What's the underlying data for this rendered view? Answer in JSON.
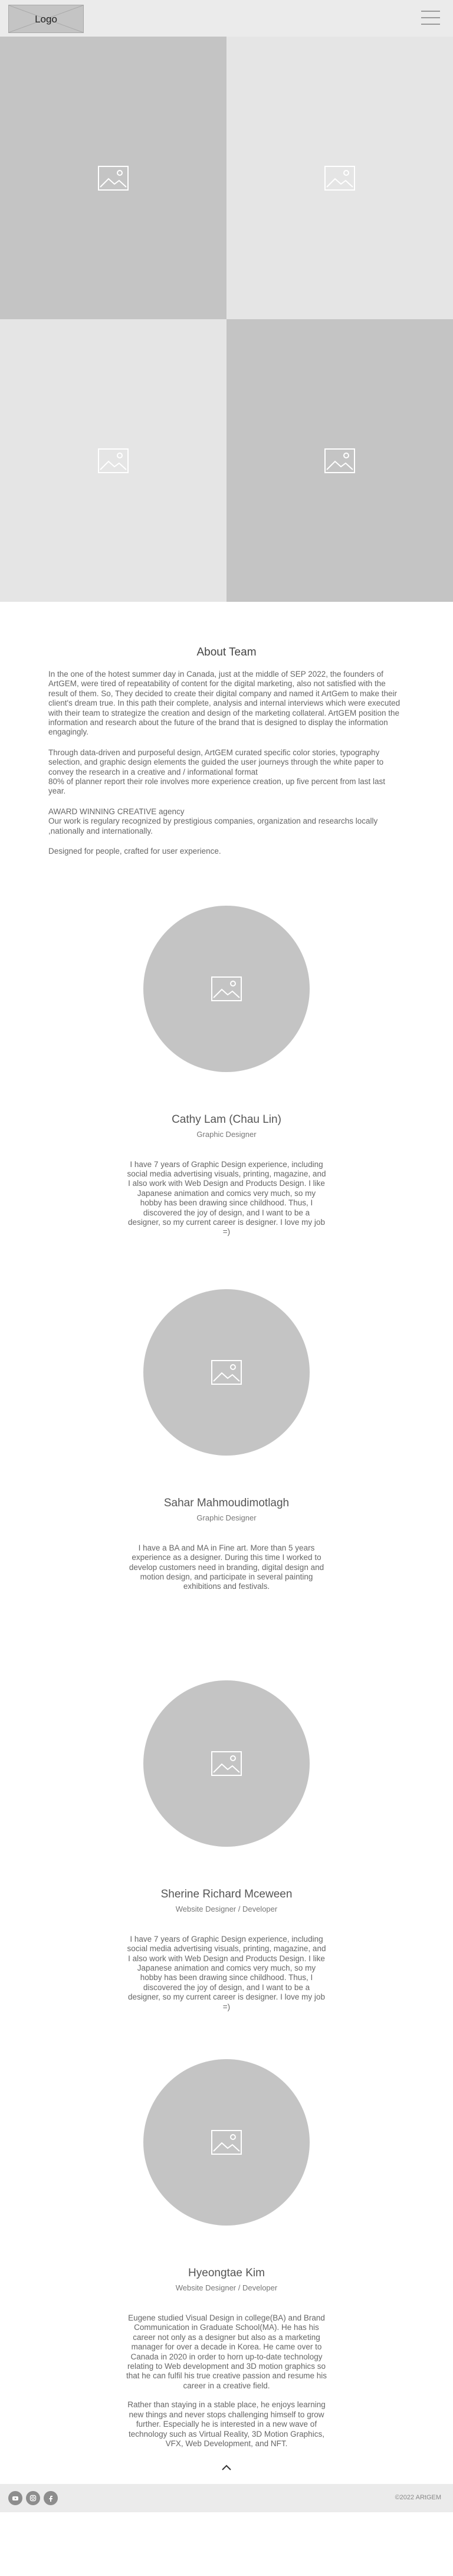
{
  "header": {
    "logo_text": "Logo"
  },
  "hero": {
    "tiles": [
      {
        "icon": "image-placeholder-icon"
      },
      {
        "icon": "image-placeholder-icon"
      },
      {
        "icon": "image-placeholder-icon"
      },
      {
        "icon": "image-placeholder-icon"
      }
    ]
  },
  "about": {
    "title": "About Team",
    "paragraph_1": "In the one of the hotest summer day in Canada, just at the middle of SEP 2022, the founders of ArtGEM, were tired of repeatability of content for the digital marketing, also not satisfied with the result of them.  So, They decided  to  create their digital company and named it ArtGem to make their client's dream true. In this path their complete, analysis and internal interviews which were executed with their team to strategize the creation and design of the marketing collateral. ArtGEM position the information and research about the future of the brand that is designed to display the information engagingly.",
    "paragraph_2_a": "Through data-driven and purposeful design, ArtGEM curated specific color stories, typography selection, and  graphic design elements the guided the user journeys through the white paper to convey the research in a creative and / informational format",
    "paragraph_2_b": "80% of planner report their role involves more experience creation, up five percent from last last year.",
    "award_title": "AWARD WINNING CREATIVE agency",
    "award_text": "Our work is regulary recognized by prestigious companies, organization and researchs locally ,nationally and internationally.",
    "closing": "Designed for people, crafted for user experience."
  },
  "team": [
    {
      "name": "Cathy Lam (Chau Lin)",
      "role": "Graphic Designer",
      "bio": [
        "I have 7 years of Graphic Design experience, including social media advertising visuals, printing, magazine, and I also work with Web Design and Products Design. I like Japanese animation and comics very much, so my hobby has been drawing since childhood. Thus, I discovered the joy of design, and I want to be a designer, so my current career is designer. I love my job =)"
      ]
    },
    {
      "name": "Sahar Mahmoudimotlagh",
      "role": "Graphic Designer",
      "bio": [
        "I have a BA and MA in Fine art. More than 5 years experience as a designer. During this time I worked to develop customers need in branding, digital design and motion design, and participate in several painting exhibitions and festivals."
      ]
    },
    {
      "name": "Sherine Richard Mceween",
      "role": "Website Designer / Developer",
      "bio": [
        "I have 7 years of Graphic Design experience, including social media advertising visuals, printing, magazine, and I also work with Web Design and Products Design. I like Japanese animation and comics very much, so my hobby has been drawing since childhood. Thus, I discovered the joy of design, and I want to be a designer, so my current career is designer. I love my job =)"
      ]
    },
    {
      "name": "Hyeongtae Kim",
      "role": "Website Designer / Developer",
      "bio": [
        "Eugene studied Visual Design in college(BA) and Brand Communication in Graduate School(MA). He has his career not only as a designer but also as a marketing manager for over a decade in Korea. He came over to Canada in 2020 in order to horn up-to-date technology relating to Web development and 3D motion graphics so that he can fulfil his true creative passion and resume his career in a creative field.",
        "Rather than staying in a stable place, he enjoys learning new things and never stops challenging himself to grow further. Especially he is interested in a new wave of technology such as Virtual Reality, 3D Motion Graphics, VFX, Web Development, and NFT."
      ]
    }
  ],
  "footer": {
    "socials": [
      "youtube-icon",
      "instagram-icon",
      "facebook-icon"
    ],
    "copyright": "©2022 ARtGEM"
  },
  "colors": {
    "header_bg": "#ebebeb",
    "placeholder_dark": "#c4c4c4",
    "placeholder_light": "#e5e5e5"
  }
}
